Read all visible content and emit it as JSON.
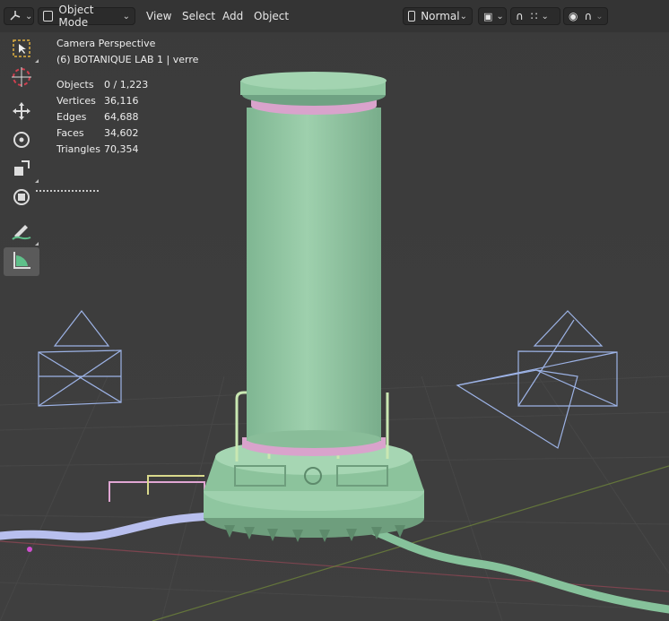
{
  "header": {
    "mode_label": "Object Mode",
    "menus": [
      "View",
      "Select",
      "Add",
      "Object"
    ],
    "orientation_label": "Normal"
  },
  "overlay": {
    "view_name": "Camera Perspective",
    "collection_line": "(6) BOTANIQUE LAB 1 | verre",
    "stats": [
      {
        "label": "Objects",
        "value": "0 / 1,223"
      },
      {
        "label": "Vertices",
        "value": "36,116"
      },
      {
        "label": "Edges",
        "value": "64,688"
      },
      {
        "label": "Faces",
        "value": "34,602"
      },
      {
        "label": "Triangles",
        "value": "70,354"
      }
    ]
  },
  "toolbar": {
    "tools": [
      "select-box",
      "cursor",
      "move",
      "rotate",
      "scale",
      "transform",
      "annotate",
      "measure"
    ],
    "active_tool": "measure"
  },
  "colors": {
    "viewport_bg": "#3d3d3d",
    "object_green": "#8fc6a0",
    "object_pink": "#d9a3cc",
    "camera_wire": "#9db3e6",
    "grid_x_axis": "#a5485a",
    "grid_y_axis": "#7d9a3a"
  }
}
